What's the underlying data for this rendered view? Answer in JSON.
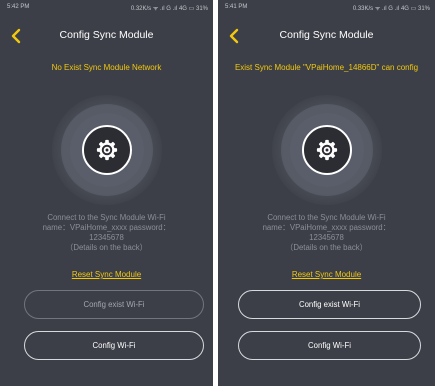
{
  "screens": [
    {
      "status_bar": {
        "time": "5:42 PM",
        "info": "0.32K/s ᯤ .ıl G .ıl 4G ▭ 31%"
      },
      "header": {
        "title": "Config Sync Module"
      },
      "message": "No Exist Sync Module Network",
      "instructions": [
        "Connect to the Sync Module Wi-Fi",
        "name：VPaiHome_xxxx password：",
        "12345678",
        "（Details on the back）"
      ],
      "reset_link": "Reset Sync Module",
      "buttons": {
        "config_exist_wifi": "Config exist Wi-Fi",
        "config_wifi": "Config Wi-Fi"
      }
    },
    {
      "status_bar": {
        "time": "5:41 PM",
        "info": "0.33K/s ᯤ .ıl G .ıl 4G ▭ 31%"
      },
      "header": {
        "title": "Config Sync Module"
      },
      "message": "Exist Sync Module \"VPaiHome_14866D\" can config",
      "instructions": [
        "Connect to the Sync Module Wi-Fi",
        "name：VPaiHome_xxxx password：",
        "12345678",
        "（Details on the back）"
      ],
      "reset_link": "Reset Sync Module",
      "buttons": {
        "config_exist_wifi": "Config exist Wi-Fi",
        "config_wifi": "Config Wi-Fi"
      }
    }
  ],
  "colors": {
    "background": "#3c3f47",
    "accent": "#f2c80f",
    "text_primary": "#ffffff",
    "text_muted": "#8c8f97"
  },
  "icons": {
    "back": "chevron-left-icon",
    "sync": "gear-icon"
  }
}
